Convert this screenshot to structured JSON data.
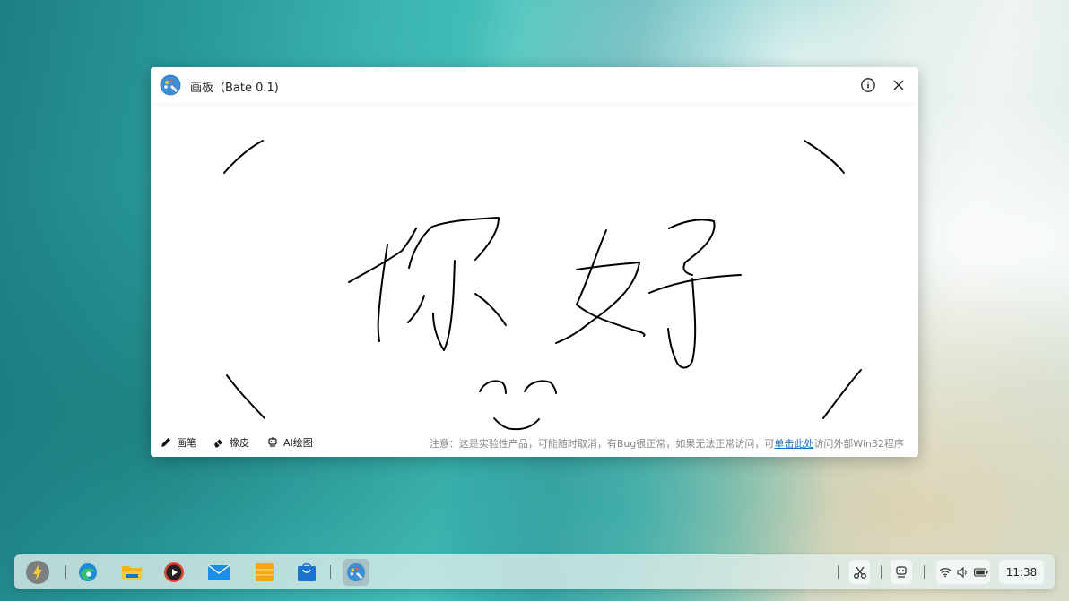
{
  "window": {
    "title": "画板（Bate 0.1)",
    "info_icon": "info-icon",
    "close_icon": "close-icon"
  },
  "toolbar": {
    "pen_label": "画笔",
    "eraser_label": "橡皮",
    "ai_label": "AI绘图"
  },
  "notice": {
    "prefix": "注意：这是实验性产品，可能随时取消，有Bug很正常，如果无法正常访问，可",
    "link": "单击此处",
    "suffix": "访问外部Win32程序"
  },
  "taskbar": {
    "apps": [
      "launcher",
      "edge",
      "file-explorer",
      "media-player",
      "mail",
      "notes",
      "store",
      "paint-board"
    ],
    "tray_icons": [
      "scissors-icon",
      "assistant-icon",
      "wifi-icon",
      "volume-icon",
      "battery-icon"
    ],
    "clock": "11:38"
  },
  "colors": {
    "accent": "#1a6fc4",
    "ink": "#000000"
  }
}
